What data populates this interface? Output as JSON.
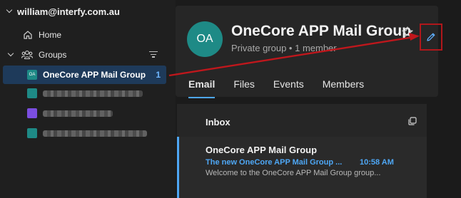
{
  "sidebar": {
    "account": "william@interfy.com.au",
    "home_label": "Home",
    "groups_label": "Groups",
    "groups": [
      {
        "initials": "OA",
        "name": "OneCore APP Mail Group",
        "count": "1",
        "active": true,
        "color": "#1e8a86"
      },
      {
        "redacted": true,
        "color": "#1e8a86"
      },
      {
        "redacted": true,
        "color": "#7b4ee0"
      },
      {
        "redacted": true,
        "color": "#1e8a86"
      }
    ]
  },
  "group": {
    "initials": "OA",
    "name": "OneCore APP Mail Group",
    "subtitle": "Private group • 1 member"
  },
  "tabs": [
    "Email",
    "Files",
    "Events",
    "Members"
  ],
  "inbox": {
    "title": "Inbox",
    "message": {
      "from": "OneCore APP Mail Group",
      "subject": "The new OneCore APP Mail Group ...",
      "time": "10:58 AM",
      "preview": "Welcome to the OneCore APP Mail Group group..."
    }
  },
  "colors": {
    "accent": "#4ea7f5",
    "annotation": "#c0171c",
    "avatar": "#1e8a86"
  }
}
